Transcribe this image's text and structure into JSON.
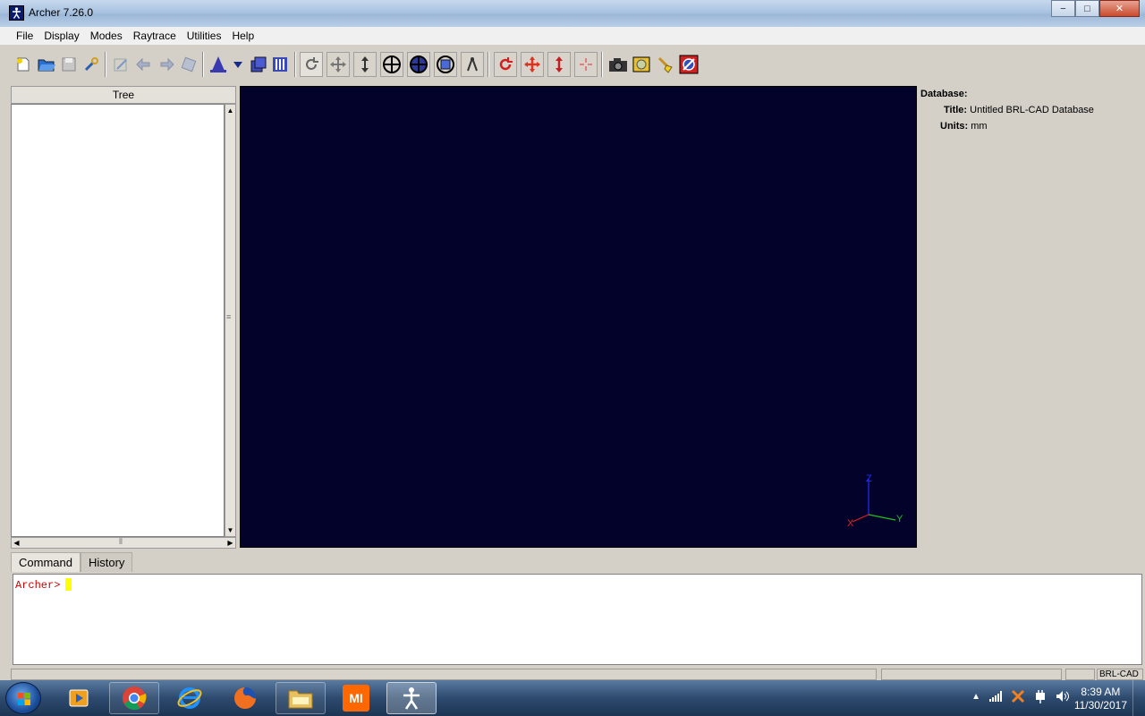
{
  "window": {
    "title": "Archer 7.26.0",
    "controls": {
      "minimize": "−",
      "maximize": "□",
      "close": "✕"
    }
  },
  "menu": [
    "File",
    "Display",
    "Modes",
    "Raytrace",
    "Utilities",
    "Help"
  ],
  "toolbar": {
    "icons": [
      "new-file-icon",
      "open-folder-icon",
      "save-icon",
      "wrench-icon",
      "edit-icon",
      "undo-icon",
      "redo-icon",
      "tool-icon",
      "wizard-icon",
      "dropdown-icon",
      "layers-icon",
      "grid-icon",
      "rotate-view-icon",
      "translate-view-icon",
      "scale-view-icon",
      "center-view-icon",
      "globe-view-icon",
      "cube-view-icon",
      "measure-icon",
      "rotate-object-icon",
      "translate-object-icon",
      "scale-object-icon",
      "center-object-icon",
      "camera-icon",
      "render-icon",
      "clear-icon",
      "no-entry-icon"
    ]
  },
  "tree": {
    "header": "Tree"
  },
  "viewport": {
    "background": "#02022a",
    "axes": {
      "x": "X",
      "y": "Y",
      "z": "Z"
    }
  },
  "properties": {
    "section": "Database:",
    "title_label": "Title:",
    "title_value": "Untitled BRL-CAD Database",
    "units_label": "Units:",
    "units_value": "mm"
  },
  "tabs": [
    "Command",
    "History"
  ],
  "console": {
    "prompt": "Archer>"
  },
  "status": {
    "right_label": "BRL-CAD"
  },
  "taskbar": {
    "apps": [
      "media-player-icon",
      "chrome-icon",
      "internet-explorer-icon",
      "firefox-icon",
      "file-explorer-icon",
      "mi-icon",
      "archer-icon"
    ],
    "mi_label": "MI",
    "time": "8:39 AM",
    "date": "11/30/2017"
  }
}
